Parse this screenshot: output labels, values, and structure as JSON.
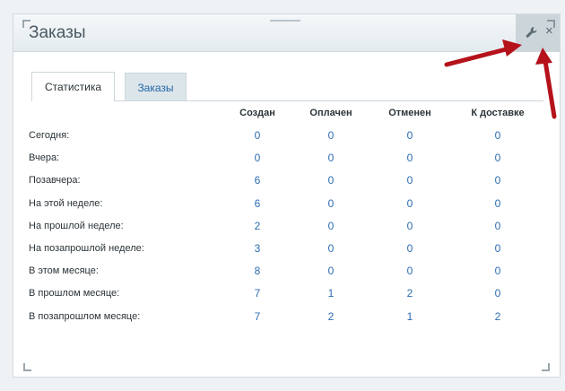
{
  "widget": {
    "title": "Заказы",
    "tools": {
      "settings_icon": "wrench-icon",
      "close_glyph": "×"
    }
  },
  "tabs": [
    {
      "label": "Статистика",
      "active": true
    },
    {
      "label": "Заказы",
      "active": false
    }
  ],
  "table": {
    "columns": [
      "Создан",
      "Оплачен",
      "Отменен",
      "К доставке"
    ],
    "rows": [
      {
        "label": "Сегодня:",
        "values": [
          "0",
          "0",
          "0",
          "0"
        ]
      },
      {
        "label": "Вчера:",
        "values": [
          "0",
          "0",
          "0",
          "0"
        ]
      },
      {
        "label": "Позавчера:",
        "values": [
          "6",
          "0",
          "0",
          "0"
        ]
      },
      {
        "label": "На этой неделе:",
        "values": [
          "6",
          "0",
          "0",
          "0"
        ]
      },
      {
        "label": "На прошлой неделе:",
        "values": [
          "2",
          "0",
          "0",
          "0"
        ]
      },
      {
        "label": "На позапрошлой неделе:",
        "values": [
          "3",
          "0",
          "0",
          "0"
        ]
      },
      {
        "label": "В этом месяце:",
        "values": [
          "8",
          "0",
          "0",
          "0"
        ]
      },
      {
        "label": "В прошлом месяце:",
        "values": [
          "7",
          "1",
          "2",
          "0"
        ]
      },
      {
        "label": "В позапрошлом месяце:",
        "values": [
          "7",
          "2",
          "1",
          "2"
        ]
      }
    ]
  },
  "colors": {
    "value_link": "#2c6cb0",
    "arrow": "#b5121b"
  }
}
